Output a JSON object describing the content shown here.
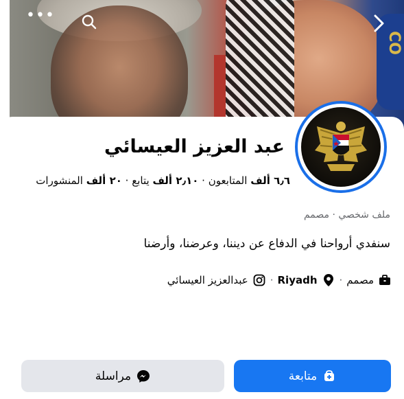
{
  "cover": {
    "more_icon": "more-dots-icon",
    "search_icon": "search-icon",
    "forward_icon": "chevron-right-icon",
    "sign_text": "CO"
  },
  "profile": {
    "name": "عبد العزيز العيسائي",
    "stats": {
      "followers_value": "٦٫٦ ألف",
      "followers_label": "المتابعون",
      "following_value": "٢٫١٠ ألف",
      "following_label": "يتابع",
      "posts_value": "٢٠ ألف",
      "posts_label": "المنشورات",
      "separator": "·"
    },
    "category": "ملف شخصي · مصمم",
    "bio": "سنفدي أرواحنا في الدفاع عن ديننا، وعرضنا، وأرضنا",
    "details": {
      "job": "مصمم",
      "location": "Riyadh",
      "instagram": "عبدالعزيز العيسائي",
      "separator": "·"
    }
  },
  "buttons": {
    "follow": "متابعة",
    "message": "مراسلة"
  },
  "colors": {
    "accent": "#1877f2",
    "avatar_ring": "#1a6fe8",
    "secondary_button": "#e4e6eb",
    "muted_text": "#65676b"
  }
}
